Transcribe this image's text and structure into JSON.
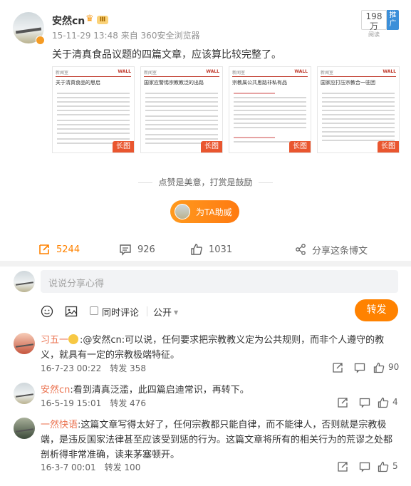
{
  "post": {
    "author": "安然cn",
    "level": "Ⅲ",
    "timestamp": "15-11-29 13:48",
    "source_prefix": "来自",
    "source": "360安全浏览器",
    "read_count": "198万",
    "read_label": "阅读",
    "promo_label": "推广",
    "text": "关于清真食品议题的四篇文章，应该算比较完整了。",
    "images": [
      {
        "title": "关于清真食品的思启",
        "tag": "长图"
      },
      {
        "title": "国家应警惕宗教教泛的出路",
        "tag": "长图"
      },
      {
        "title": "宗教属公共思路非私有品",
        "tag": "长图"
      },
      {
        "title": "国家应打压宗教合一驻团",
        "tag": "长图"
      }
    ],
    "like_hint": "点赞是美意，打赏是鼓励",
    "tip_button": "为TA助威"
  },
  "actions": {
    "repost": "5244",
    "comment": "926",
    "like": "1031",
    "share": "分享这条博文"
  },
  "compose": {
    "placeholder": "说说分享心得",
    "also_comment": "同时评论",
    "visibility": "公开",
    "send": "转发"
  },
  "comments": [
    {
      "name": "习五一",
      "text": ":@安然cn:可以说，任何要求把宗教教义定为公共规则，而非个人遵守的教义，就具有一定的宗教极端特征。",
      "time": "16-7-23 00:22",
      "repost": "转发 358",
      "likes": "90"
    },
    {
      "name": "安然cn",
      "text": ":看到清真泛滥，此四篇启迪常识，再转下。",
      "time": "16-5-19 15:01",
      "repost": "转发 476",
      "likes": "4"
    },
    {
      "name": "一然快语",
      "text": ":这篇文章写得太好了，任何宗教都只能自律，而不能律人，否则就是宗教极端，是违反国家法律甚至应该受到惩的行为。这篇文章将所有的相关行为的荒谬之处都剖析得非常准确，读来茅塞顿开。",
      "time": "16-3-7 00:01",
      "repost": "转发 100",
      "likes": "5"
    }
  ],
  "colors": {
    "accent": "#ff8200",
    "name": "#eb7350",
    "longtag": "#e9562f"
  }
}
